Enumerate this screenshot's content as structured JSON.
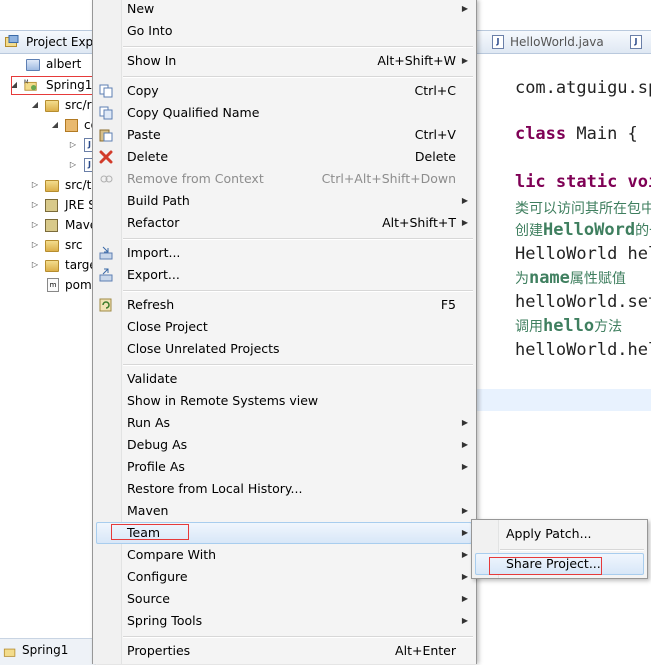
{
  "explorer": {
    "tab_title": "Project Expl",
    "tree": [
      {
        "label": "albert",
        "icon": "folder-icon"
      },
      {
        "label": "Spring1",
        "icon": "maven-project-icon"
      },
      {
        "label": "src/r",
        "icon": "source-folder-icon"
      },
      {
        "label": "co",
        "icon": "package-icon"
      },
      {
        "label": "J",
        "icon": "java-file-icon"
      },
      {
        "label": "J",
        "icon": "java-file-icon"
      },
      {
        "label": "src/t",
        "icon": "source-folder-icon"
      },
      {
        "label": "JRE S",
        "icon": "library-icon"
      },
      {
        "label": "Mave",
        "icon": "library-icon"
      },
      {
        "label": "src",
        "icon": "folder-icon"
      },
      {
        "label": "targe",
        "icon": "folder-icon"
      },
      {
        "label": "pom",
        "icon": "pom-file-icon"
      }
    ],
    "status_label": "Spring1"
  },
  "editor": {
    "tabs": [
      {
        "label": "HelloWorld.java"
      },
      {
        "label": "J"
      }
    ],
    "code": {
      "line1": "com.atguigu.sp",
      "line2_kw": "class",
      "line2_rest": " Main {",
      "line3_kw1": "lic static",
      "line3_kw2": " void",
      "comment1": "类可以访问其所在包中的",
      "comment2_a": "创建",
      "comment2_b": "HelloWord",
      "comment2_c": "的一",
      "line4": "HelloWorld hel",
      "comment3_a": "为",
      "comment3_b": "name",
      "comment3_c": "属性赋值",
      "line5": "helloWorld.set",
      "comment4_a": "调用",
      "comment4_b": "hello",
      "comment4_c": "方法",
      "line6": "helloWorld.hel"
    }
  },
  "context_menu": {
    "items": {
      "new": {
        "label": "New"
      },
      "go_into": {
        "label": "Go Into"
      },
      "show_in": {
        "label": "Show In",
        "shortcut": "Alt+Shift+W"
      },
      "copy": {
        "label": "Copy",
        "shortcut": "Ctrl+C"
      },
      "copy_qualified_name": {
        "label": "Copy Qualified Name"
      },
      "paste": {
        "label": "Paste",
        "shortcut": "Ctrl+V"
      },
      "delete": {
        "label": "Delete",
        "shortcut": "Delete"
      },
      "remove_from_context": {
        "label": "Remove from Context",
        "shortcut": "Ctrl+Alt+Shift+Down"
      },
      "build_path": {
        "label": "Build Path"
      },
      "refactor": {
        "label": "Refactor",
        "shortcut": "Alt+Shift+T"
      },
      "import": {
        "label": "Import..."
      },
      "export": {
        "label": "Export..."
      },
      "refresh": {
        "label": "Refresh",
        "shortcut": "F5"
      },
      "close_project": {
        "label": "Close Project"
      },
      "close_unrelated": {
        "label": "Close Unrelated Projects"
      },
      "validate": {
        "label": "Validate"
      },
      "show_remote": {
        "label": "Show in Remote Systems view"
      },
      "run_as": {
        "label": "Run As"
      },
      "debug_as": {
        "label": "Debug As"
      },
      "profile_as": {
        "label": "Profile As"
      },
      "restore_history": {
        "label": "Restore from Local History..."
      },
      "maven": {
        "label": "Maven"
      },
      "team": {
        "label": "Team"
      },
      "compare_with": {
        "label": "Compare With"
      },
      "configure": {
        "label": "Configure"
      },
      "source": {
        "label": "Source"
      },
      "spring_tools": {
        "label": "Spring Tools"
      },
      "properties": {
        "label": "Properties",
        "shortcut": "Alt+Enter"
      }
    }
  },
  "team_submenu": {
    "apply_patch": {
      "label": "Apply Patch..."
    },
    "share_project": {
      "label": "Share Project..."
    }
  }
}
